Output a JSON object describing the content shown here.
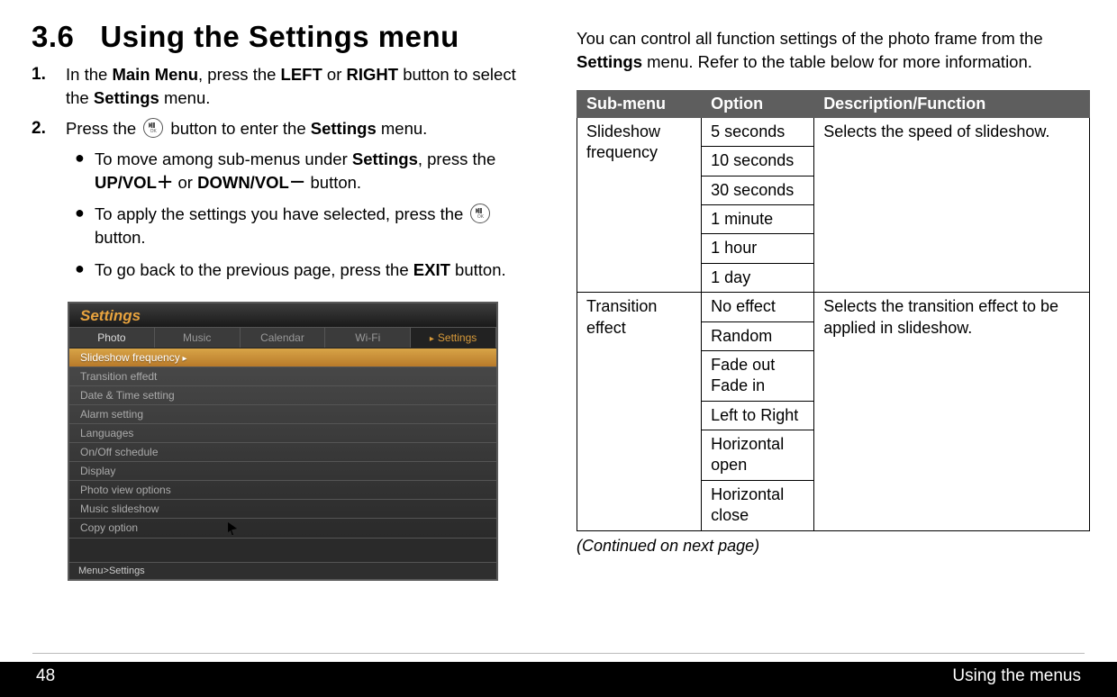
{
  "header": {
    "section_number": "3.6",
    "section_title": "Using the Settings menu"
  },
  "steps": [
    {
      "num": "1.",
      "prefix": "In the ",
      "b1": "Main Menu",
      "mid1": ", press the ",
      "b2": "LEFT",
      "mid2": " or ",
      "b3": "RIGHT",
      "mid3": " button to select the ",
      "b4": "Settings",
      "suffix": " menu."
    },
    {
      "num": "2.",
      "prefix": "Press the ",
      "mid1": " button to enter the ",
      "b1": "Settings",
      "suffix": " menu."
    }
  ],
  "bullets": [
    {
      "t1": "To move among sub-menus under ",
      "b1": "Settings",
      "t2": ", press the ",
      "b2": "UP/VOL＋",
      "t3": " or ",
      "b3": "DOWN/VOL－",
      "t4": " button."
    },
    {
      "t1": "To apply the settings you have selected, press the ",
      "t2": " button."
    },
    {
      "t1": "To go back to the previous page, press the ",
      "b1": "EXIT",
      "t2": " button."
    }
  ],
  "screenshot": {
    "title": "Settings",
    "tabs": [
      "Photo",
      "Music",
      "Calendar",
      "Wi-Fi",
      "Settings"
    ],
    "rows": [
      "Slideshow frequency",
      "Transition effedt",
      "Date & Time setting",
      "Alarm setting",
      "Languages",
      "On/Off schedule",
      "Display",
      "Photo view options",
      "Music slideshow",
      "Copy option"
    ],
    "breadcrumb": "Menu>Settings"
  },
  "right_intro": {
    "t1": "You can control all function settings of the photo frame from the ",
    "b1": "Settings",
    "t2": " menu. Refer to the table below for more information."
  },
  "table": {
    "headers": [
      "Sub-menu",
      "Option",
      "Description/Function"
    ],
    "groups": [
      {
        "submenu": "Slideshow frequency",
        "options": [
          "5 seconds",
          "10 seconds",
          "30 seconds",
          "1 minute",
          "1 hour",
          "1 day"
        ],
        "desc": "Selects the speed of slideshow."
      },
      {
        "submenu": "Transition effect",
        "options": [
          "No effect",
          "Random",
          "Fade out Fade in",
          "Left to Right",
          "Horizontal open",
          "Horizontal close"
        ],
        "desc": "Selects the transition effect to be applied in slideshow."
      }
    ]
  },
  "continued": "(Continued on next page)",
  "footer": {
    "page": "48",
    "section": "Using the menus"
  }
}
